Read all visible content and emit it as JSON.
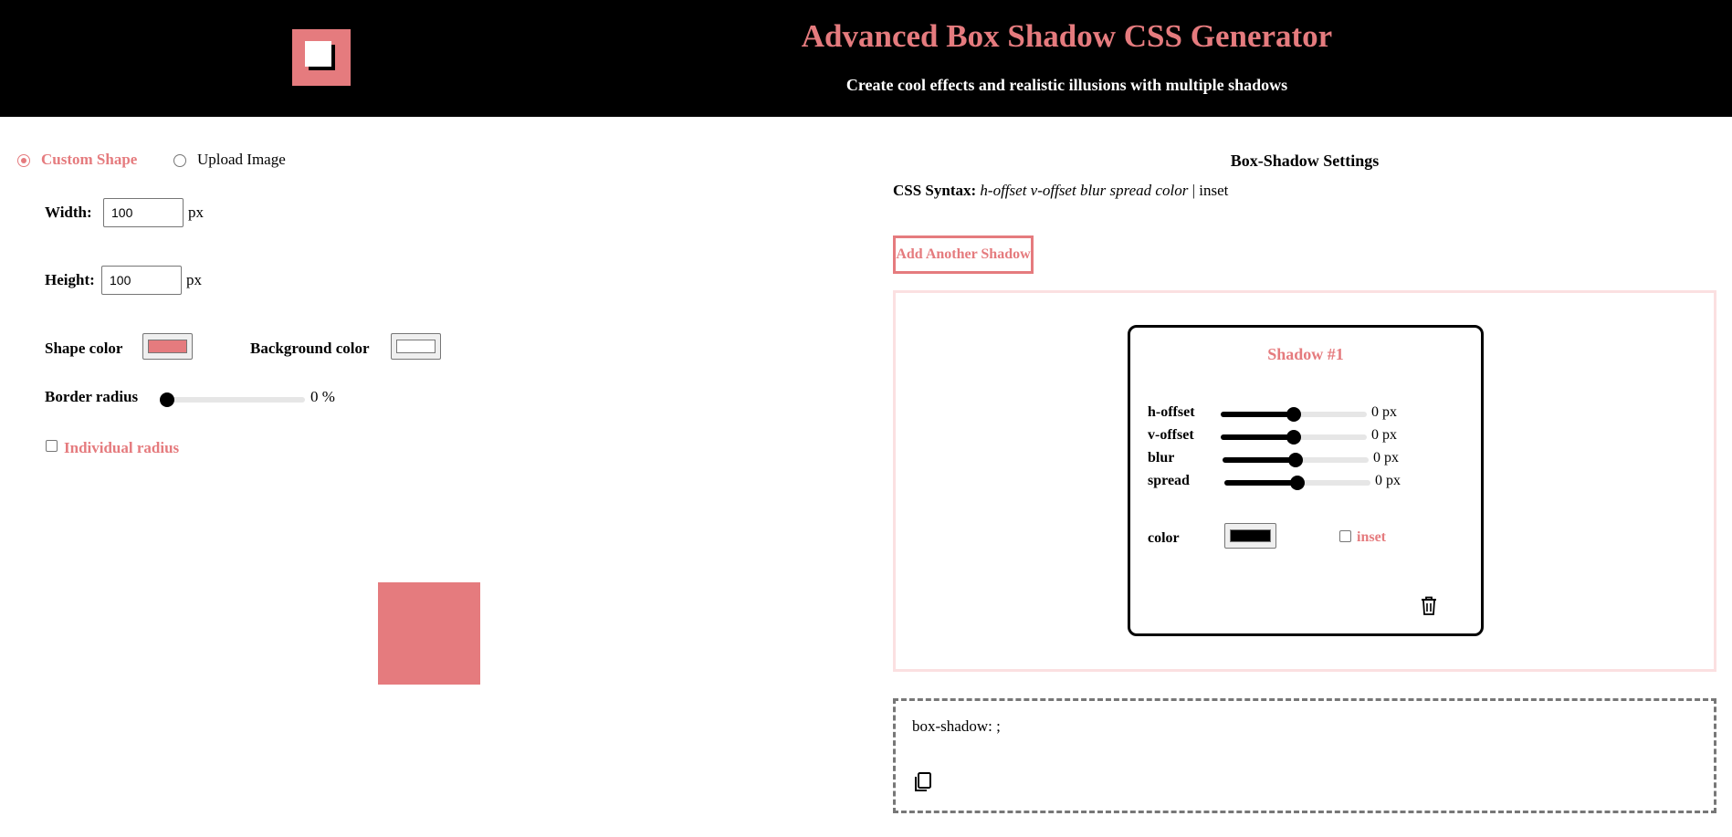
{
  "header": {
    "title": "Advanced Box Shadow CSS Generator",
    "subtitle": "Create cool effects and realistic illusions with multiple shadows",
    "logo_icon": "box-shadow-logo-icon"
  },
  "shape_mode": {
    "options": [
      {
        "label": "Custom Shape",
        "selected": true
      },
      {
        "label": "Upload Image",
        "selected": false
      }
    ]
  },
  "shape": {
    "width_label": "Width:",
    "width_value": "100",
    "width_unit": "px",
    "height_label": "Height:",
    "height_value": "100",
    "height_unit": "px",
    "shape_color_label": "Shape color",
    "shape_color": "#e57b7e",
    "background_color_label": "Background color",
    "background_color": "#ffffff",
    "border_radius_label": "Border radius",
    "border_radius_value": "0 %",
    "border_radius_level": 0,
    "individual_radius_label": "Individual radius",
    "individual_radius_checked": false
  },
  "settings": {
    "title": "Box-Shadow Settings",
    "syntax_label": "CSS Syntax:",
    "syntax_value": "h-offset v-offset blur spread color",
    "syntax_sep": "|",
    "syntax_inset": "inset",
    "add_button": "Add Another Shadow"
  },
  "shadows": [
    {
      "title": "Shadow #1",
      "h_offset_label": "h-offset",
      "h_offset_value": "0 px",
      "v_offset_label": "v-offset",
      "v_offset_value": "0 px",
      "blur_label": "blur",
      "blur_value": "0 px",
      "spread_label": "spread",
      "spread_value": "0 px",
      "color_label": "color",
      "color": "#000000",
      "inset_label": "inset",
      "inset_checked": false,
      "delete_icon": "trash-icon"
    }
  ],
  "output": {
    "code": "box-shadow: ;",
    "copy_icon": "copy-icon"
  },
  "colors": {
    "accent": "#e57b7e",
    "header_bg": "#000000",
    "panel_border": "#fbe0e1"
  }
}
